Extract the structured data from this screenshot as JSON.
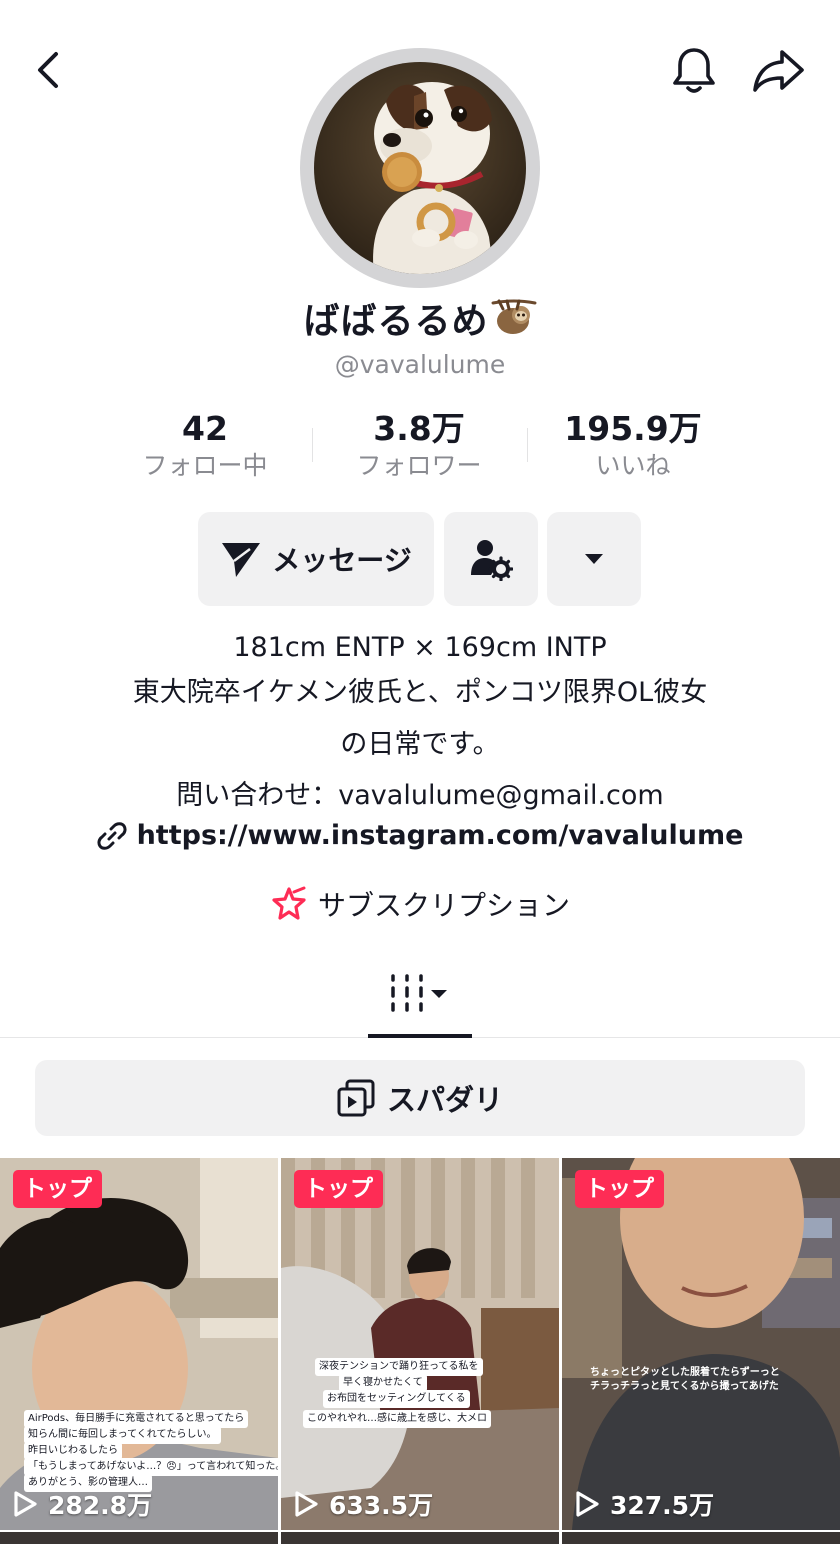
{
  "profile": {
    "display_name": "ばばるるめ",
    "handle": "@vavalulume"
  },
  "stats": [
    {
      "value": "42",
      "label": "フォロー中"
    },
    {
      "value": "3.8万",
      "label": "フォロワー"
    },
    {
      "value": "195.9万",
      "label": "いいね"
    }
  ],
  "actions": {
    "message_label": "メッセージ"
  },
  "bio": {
    "line1": "181cm ENTP × 169cm INTP",
    "line2": "東大院卒イケメン彼氏と、ポンコツ限界OL彼女",
    "line3": "の日常です。",
    "line4": "問い合わせ：vavalulume@gmail.com"
  },
  "link": {
    "url": "https://www.instagram.com/vavalulume"
  },
  "subscription": {
    "label": "サブスクリプション"
  },
  "playlist": {
    "label": "スパダリ"
  },
  "videos": [
    {
      "badge": "トップ",
      "views": "282.8万",
      "captions": [
        "AirPods、毎日勝手に充電されてると思ってたら",
        "知らん間に毎回しまってくれてたらしい。",
        "昨日いじわるしたら",
        "「もうしまってあげないよ…？😠」って言われて知った。",
        "ありがとう、影の管理人…"
      ]
    },
    {
      "badge": "トップ",
      "views": "633.5万",
      "captions": [
        "深夜テンションで踊り狂ってる私を",
        "早く寝かせたくて",
        "お布団をセッティングしてくる",
        "このやれやれ…感に歳上を感じ、大メロ"
      ]
    },
    {
      "badge": "トップ",
      "views": "327.5万",
      "captions": [
        "ちょっとピタッとした服着てたらずーっと",
        "チラっチラっと見てくるから撮ってあげた"
      ]
    }
  ],
  "colors": {
    "accent": "#fe2c55",
    "button_bg": "#f1f1f2",
    "muted_text": "#8a8b91"
  }
}
